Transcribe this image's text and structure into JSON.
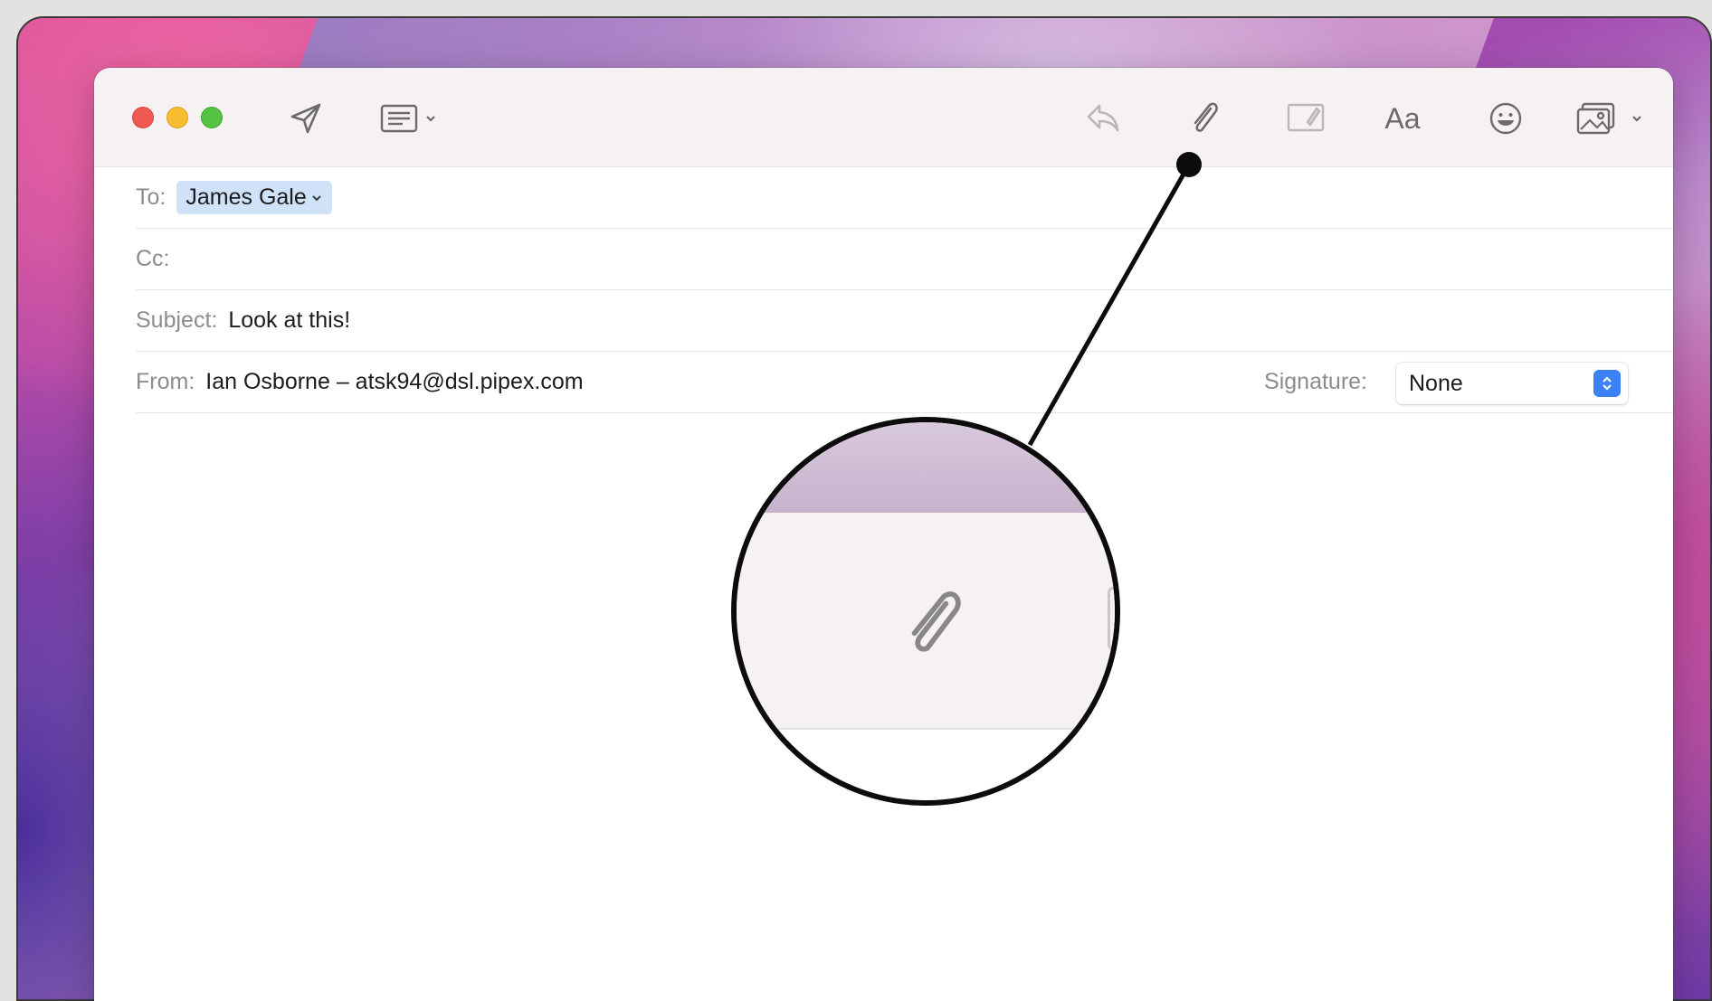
{
  "compose": {
    "to_label": "To:",
    "to_recipient": "James Gale",
    "cc_label": "Cc:",
    "subject_label": "Subject:",
    "subject_value": "Look at this!",
    "from_label": "From:",
    "from_value": "Ian Osborne – atsk94@dsl.pipex.com",
    "signature_label": "Signature:",
    "signature_value": "None"
  },
  "toolbar": {
    "format_label": "Aa",
    "icons": [
      "send-icon",
      "header-fields-icon",
      "reply-icon",
      "attach-icon",
      "markup-icon",
      "format-text-icon",
      "emoji-icon",
      "photo-browser-icon"
    ]
  },
  "colors": {
    "accent": "#3b82f6",
    "token_bg": "#cfe2f8",
    "close": "#ee5a52",
    "minimize": "#f5bd2f",
    "zoom": "#55c241"
  }
}
